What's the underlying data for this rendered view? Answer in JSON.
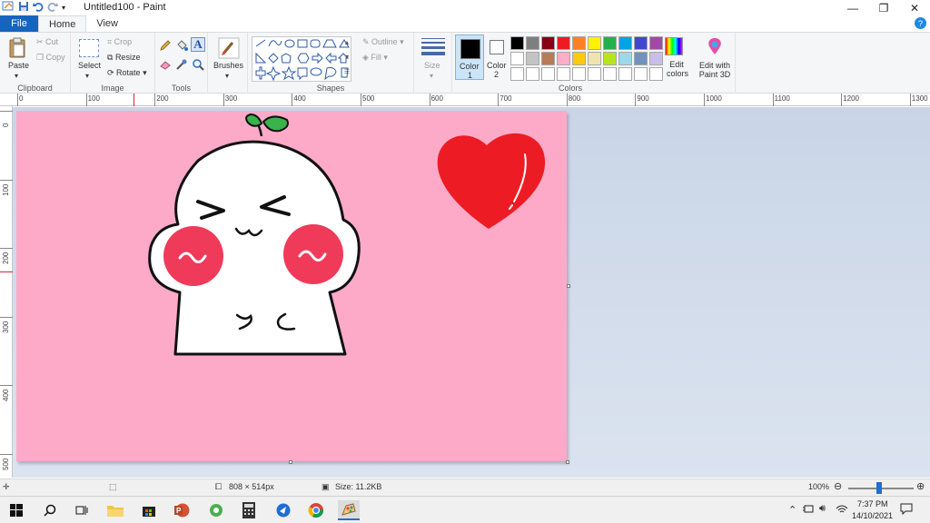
{
  "window": {
    "title": "Untitled100 - Paint",
    "minimize_glyph": "—",
    "maximize_glyph": "❐",
    "close_glyph": "✕"
  },
  "quick_access": [
    "paint-app-icon",
    "save-icon",
    "undo-icon",
    "redo-icon",
    "customize-dropdown-icon"
  ],
  "tabs": [
    {
      "label": "File"
    },
    {
      "label": "Home"
    },
    {
      "label": "View"
    }
  ],
  "help_glyph": "?",
  "ribbon": {
    "clipboard": {
      "label": "Clipboard",
      "paste": "Paste",
      "cut": "Cut",
      "copy": "Copy"
    },
    "image": {
      "label": "Image",
      "select": "Select",
      "crop": "Crop",
      "resize": "Resize",
      "rotate": "Rotate"
    },
    "tools": {
      "label": "Tools",
      "icons": [
        "pencil-icon",
        "fill-bucket-icon",
        "text-icon",
        "eraser-icon",
        "color-picker-icon",
        "magnifier-icon"
      ]
    },
    "brushes": {
      "label": "Brushes"
    },
    "shapes": {
      "label": "Shapes",
      "outline": "Outline",
      "fill": "Fill"
    },
    "size": {
      "label": "Size"
    },
    "colors": {
      "label": "Colors",
      "color1": "Color",
      "color1_num": "1",
      "color2": "Color",
      "color2_num": "2",
      "color1_value": "#000000",
      "color2_value": "#ffffff",
      "edit_colors": "Edit colors",
      "edit_with_3d": "Edit with Paint 3D",
      "palette": [
        "#000000",
        "#7f7f7f",
        "#880015",
        "#ed1c24",
        "#ff7f27",
        "#fff200",
        "#22b14c",
        "#00a2e8",
        "#3f48cc",
        "#a349a4",
        "#ffffff",
        "#c3c3c3",
        "#b97a57",
        "#ffaec9",
        "#ffc90e",
        "#efe4b0",
        "#b5e61d",
        "#99d9ea",
        "#7092be",
        "#c8bfe7",
        "#ffffff",
        "#ffffff",
        "#ffffff",
        "#ffffff",
        "#ffffff",
        "#ffffff",
        "#ffffff",
        "#ffffff",
        "#ffffff",
        "#ffffff"
      ]
    }
  },
  "ruler": {
    "h_labels": [
      "0",
      "100",
      "200",
      "300",
      "400",
      "500",
      "600",
      "700",
      "800",
      "900",
      "1000",
      "1100",
      "1200",
      "1300"
    ],
    "v_labels": [
      "0",
      "100",
      "200",
      "300",
      "400",
      "500"
    ]
  },
  "canvas": {
    "background": "#fdaac9"
  },
  "statusbar": {
    "dimensions": "808 × 514px",
    "size": "Size: 11.2KB",
    "zoom": "100%",
    "zoom_level": 1.0
  },
  "taskbar": {
    "time": "7:37 PM",
    "date": "14/10/2021",
    "apps": [
      "start-icon",
      "search-icon",
      "task-view-icon",
      "file-explorer-icon",
      "store-icon",
      "powerpoint-icon",
      "browser-green-icon",
      "calculator-icon",
      "app-blue-icon",
      "chrome-icon",
      "paint-icon"
    ]
  }
}
